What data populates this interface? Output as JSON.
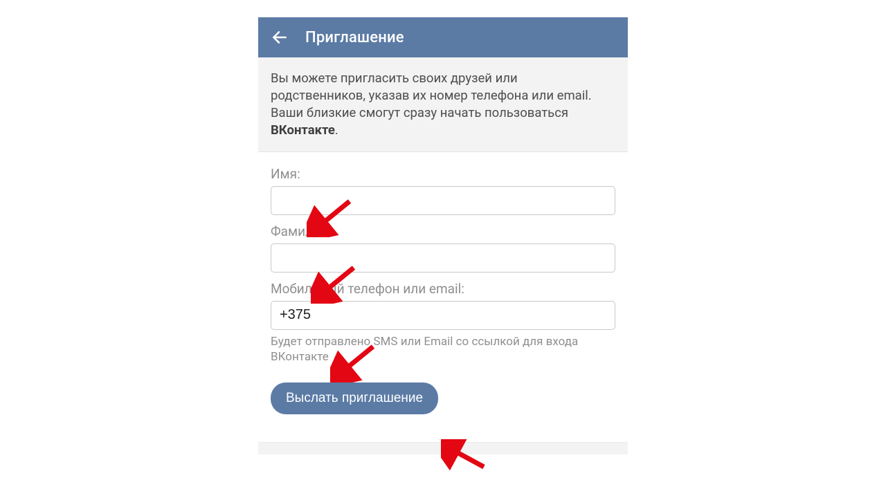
{
  "header": {
    "title": "Приглашение"
  },
  "description": {
    "text_before": "Вы можете пригласить своих друзей или родственников, указав их номер телефона или email. Ваши близкие смогут сразу начать пользоваться ",
    "brand": "ВКонтакте",
    "text_after": "."
  },
  "form": {
    "name_label": "Имя:",
    "name_value": "",
    "surname_label": "Фамилия:",
    "surname_value": "",
    "phone_label": "Мобильный телефон или email:",
    "phone_value": "+375",
    "phone_hint": "Будет отправлено SMS или Email со ссылкой для входа ВКонтакте",
    "submit_label": "Выслать приглашение"
  },
  "colors": {
    "accent": "#5b7ba5",
    "arrow": "#e30613"
  }
}
